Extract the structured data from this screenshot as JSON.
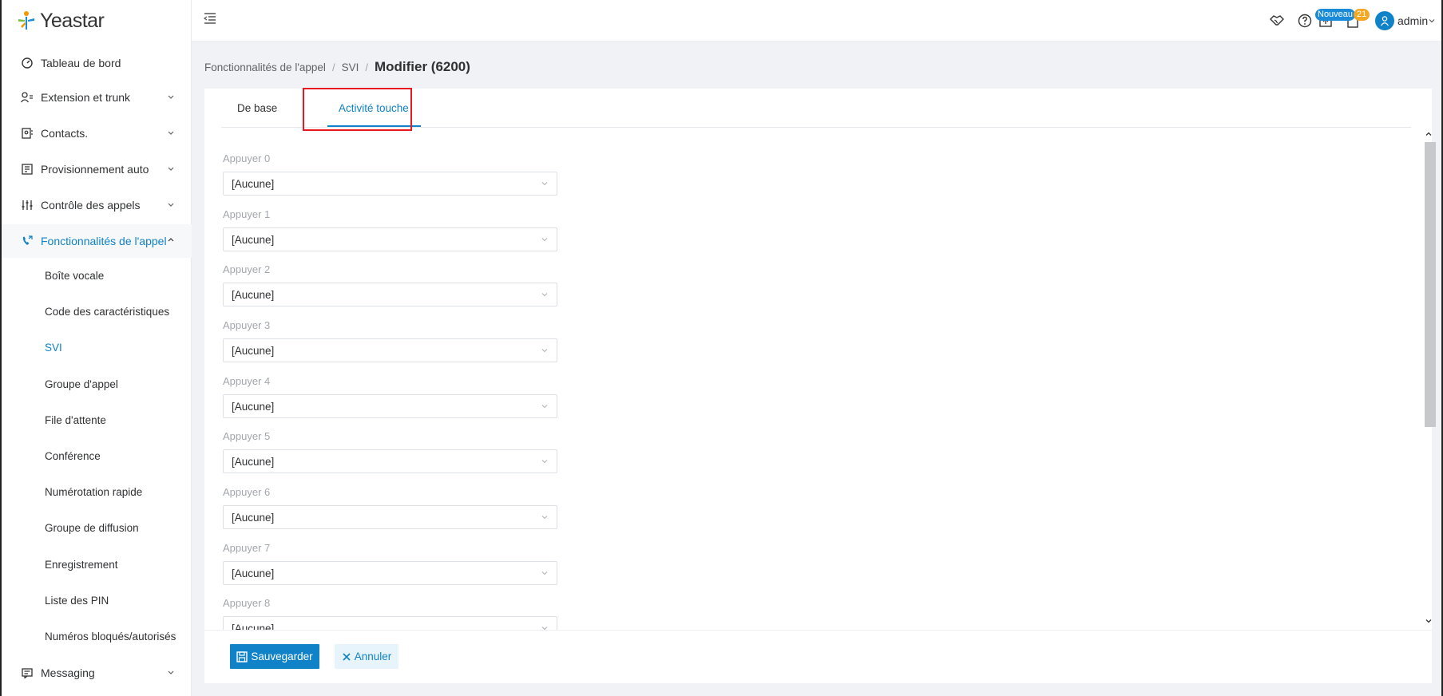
{
  "brand": {
    "name": "Yeastar"
  },
  "sidebar": {
    "items": [
      {
        "label": "Tableau de bord",
        "icon": "dashboard-icon",
        "expandable": false
      },
      {
        "label": "Extension et trunk",
        "icon": "user-list-icon",
        "expandable": true
      },
      {
        "label": "Contacts.",
        "icon": "contacts-book-icon",
        "expandable": true
      },
      {
        "label": "Provisionnement auto",
        "icon": "provisioning-icon",
        "expandable": true
      },
      {
        "label": "Contrôle des appels",
        "icon": "sliders-icon",
        "expandable": true
      },
      {
        "label": "Fonctionnalités de l'appel",
        "icon": "phone-features-icon",
        "expandable": true,
        "expanded": true
      },
      {
        "label": "Messaging",
        "icon": "chat-icon",
        "expandable": true
      }
    ],
    "subitems": [
      "Boîte vocale",
      "Code des caractéristiques",
      "SVI",
      "Groupe d'appel",
      "File d'attente",
      "Conférence",
      "Numérotation rapide",
      "Groupe de diffusion",
      "Enregistrement",
      "Liste des PIN",
      "Numéros bloqués/autorisés"
    ],
    "active_subitem": "SVI"
  },
  "header": {
    "badge_new": "Nouveau",
    "badge_count": "21",
    "user": "admin"
  },
  "breadcrumb": {
    "items": [
      "Fonctionnalités de l'appel",
      "SVI"
    ],
    "separator": "/",
    "current": "Modifier (6200)"
  },
  "tabs": [
    {
      "label": "De base",
      "active": false
    },
    {
      "label": "Activité touche",
      "active": true
    }
  ],
  "fields": [
    {
      "label": "Appuyer 0",
      "value": "[Aucune]"
    },
    {
      "label": "Appuyer 1",
      "value": "[Aucune]"
    },
    {
      "label": "Appuyer 2",
      "value": "[Aucune]"
    },
    {
      "label": "Appuyer 3",
      "value": "[Aucune]"
    },
    {
      "label": "Appuyer 4",
      "value": "[Aucune]"
    },
    {
      "label": "Appuyer 5",
      "value": "[Aucune]"
    },
    {
      "label": "Appuyer 6",
      "value": "[Aucune]"
    },
    {
      "label": "Appuyer 7",
      "value": "[Aucune]"
    },
    {
      "label": "Appuyer 8",
      "value": "[Aucune]"
    }
  ],
  "actions": {
    "save": "Sauvegarder",
    "cancel": "Annuler"
  },
  "colors": {
    "accent": "#1082c8",
    "highlight": "#e8191f",
    "badge_new": "#1a8bd9",
    "badge_count": "#f5a623"
  }
}
